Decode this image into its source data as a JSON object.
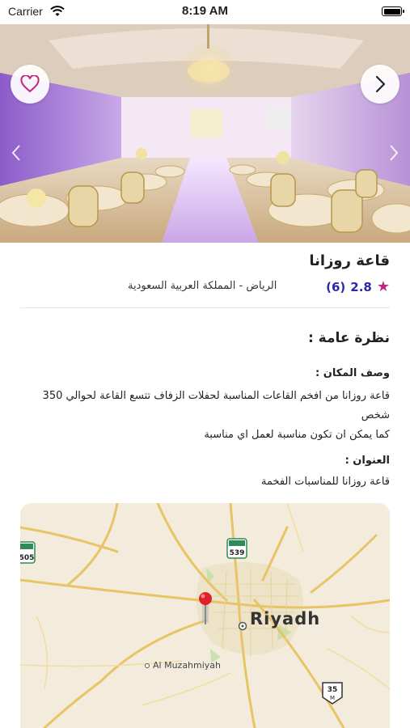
{
  "status": {
    "carrier": "Carrier",
    "time": "8:19 AM"
  },
  "hero": {
    "favorite_icon": "heart-icon",
    "next_icon": "chevron-right-icon"
  },
  "venue": {
    "name": "قاعة روزانا",
    "rating": "2.8",
    "rating_count": "(6)",
    "location": "الرياض - المملكة العربية السعودية",
    "accent": "#c0267d",
    "rating_color": "#2a2aa8"
  },
  "overview": {
    "title": "نظرة عامة :",
    "description_label": "وصف المكان :",
    "description_line1": "قاعة روزانا من افخم القاعات المناسبة لحفلات الزفاف تتسع القاعة لحوالي 350",
    "description_line2": "شخص",
    "description_line3": "كما يمكن ان تكون مناسبة لعمل اي مناسبة",
    "address_label": "العنوان :",
    "address": "قاعة روزانا للمناسبات الفخمة"
  },
  "map": {
    "city_label": "Riyadh",
    "town_label": "Al Muzahmiyah",
    "shield_539": "539",
    "shield_505": "505",
    "shield_35": "35",
    "shield_35_sub": "M"
  }
}
